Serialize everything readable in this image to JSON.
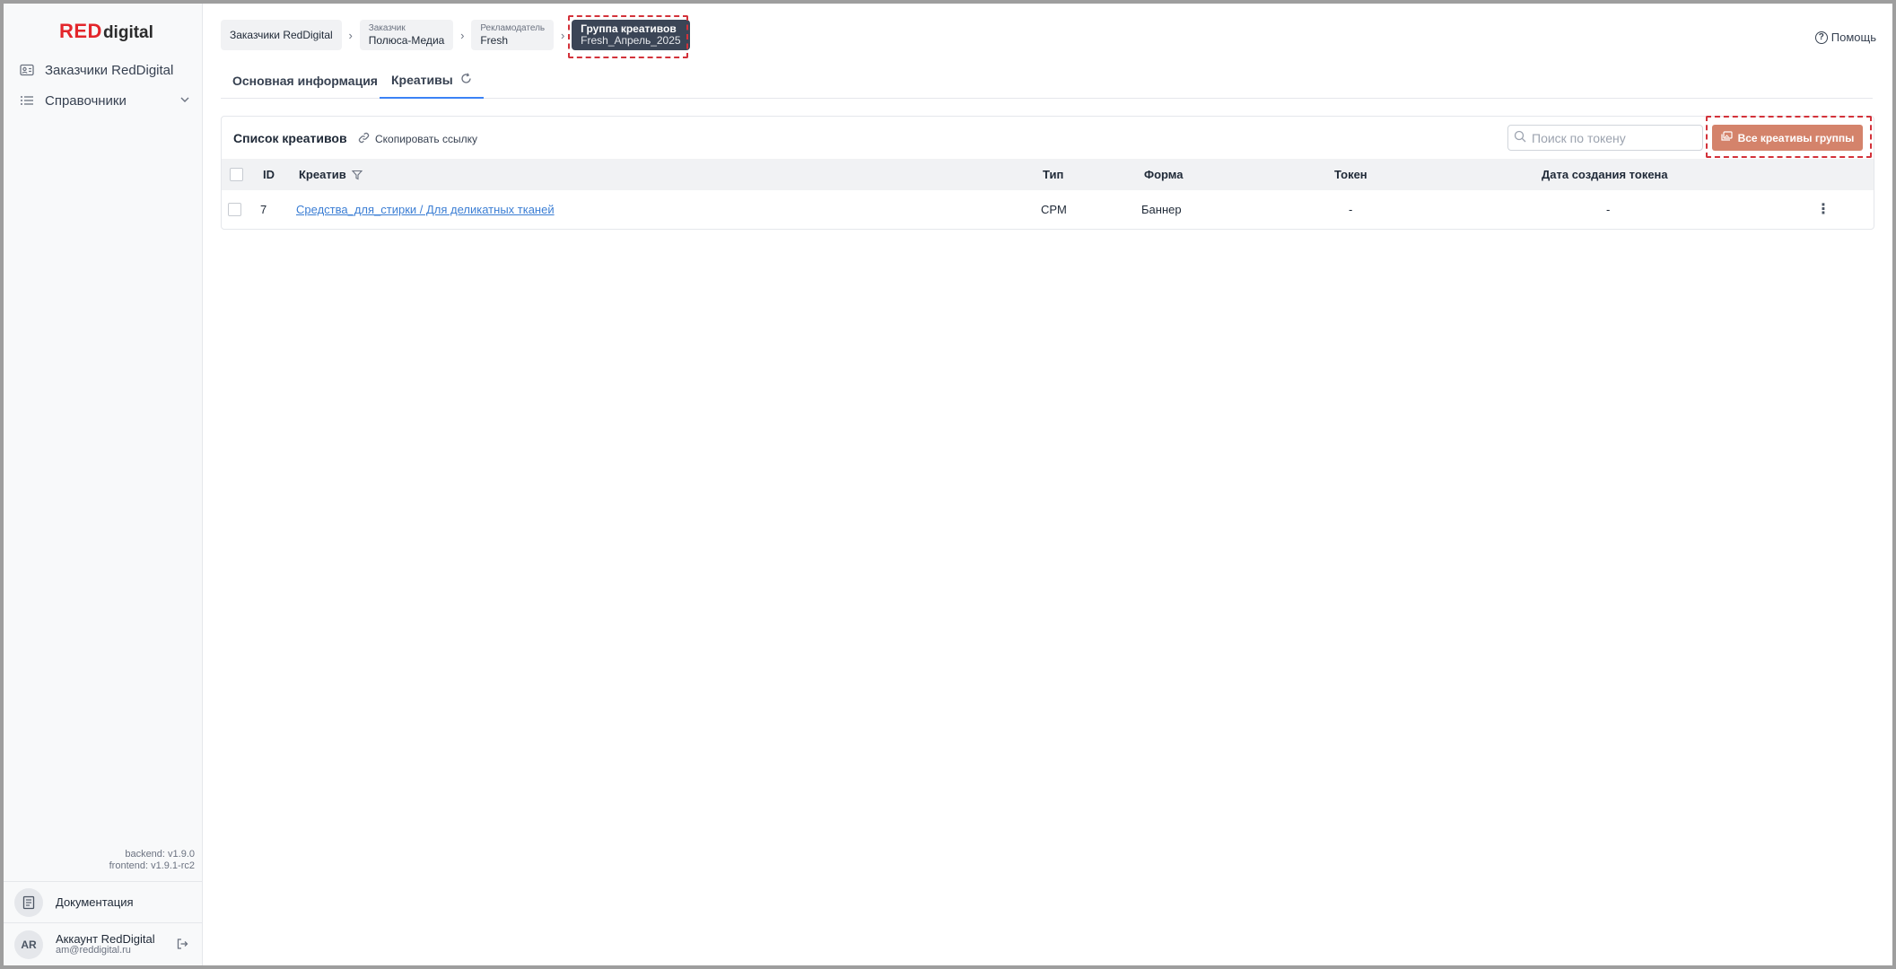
{
  "logo": {
    "red": "RED",
    "rest": "digital"
  },
  "sidebar": {
    "items": [
      {
        "label": "Заказчики RedDigital",
        "icon": "id-card-icon"
      },
      {
        "label": "Справочники",
        "icon": "list-icon"
      }
    ],
    "versions": {
      "backend": "backend: v1.9.0",
      "frontend": "frontend: v1.9.1-rc2"
    },
    "docs": {
      "label": "Документация",
      "icon": "book-icon"
    },
    "account": {
      "initials": "AR",
      "name": "Аккаунт RedDigital",
      "email": "am@reddigital.ru"
    }
  },
  "breadcrumbs": [
    {
      "title": "",
      "value": "Заказчики RedDigital"
    },
    {
      "title": "Заказчик",
      "value": "Полюса-Медиа"
    },
    {
      "title": "Рекламодатель",
      "value": "Fresh"
    },
    {
      "title": "Группа креативов",
      "value": "Fresh_Апрель_2025"
    }
  ],
  "help": {
    "label": "Помощь"
  },
  "tabs": [
    {
      "label": "Основная информация"
    },
    {
      "label": "Креативы"
    }
  ],
  "list": {
    "title": "Список креативов",
    "copy_link": "Скопировать ссылку",
    "search_placeholder": "Поиск по токену",
    "all_button": "Все креативы группы",
    "columns": [
      "ID",
      "Креатив",
      "Тип",
      "Форма",
      "Токен",
      "Дата создания токена"
    ],
    "rows": [
      {
        "id": "7",
        "creative": "Средства_для_стирки / Для деликатных тканей",
        "type": "CPM",
        "form": "Баннер",
        "token": "-",
        "token_date": "-"
      }
    ]
  },
  "colors": {
    "accent": "#3b82f6",
    "brand_red": "#e3262b",
    "button": "#d4836b",
    "highlight": "#d3323a"
  }
}
